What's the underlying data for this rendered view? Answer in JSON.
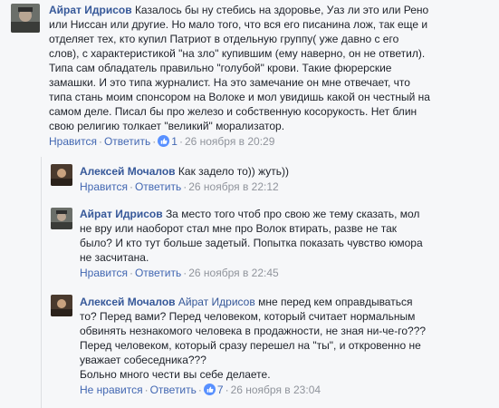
{
  "comments": [
    {
      "author": "Айрат Идрисов",
      "text_lines": [
        "Казалось бы ну стебись на здоровье, Уаз ли это или Рено",
        "или Ниссан или другие. Но мало того, что вся его писанина лож, так еще и",
        "отделяет тех, кто купил Патриот в отдельную группу( уже давно с его",
        "слов), с характеристикой \"на зло\" купившим (ему наверно, он не ответил).",
        "Типа сам обладатель правильно \"голубой\" крови. Такие фюрерские",
        "замашки. И это типа журналист. На это замечание он мне отвечает, что",
        "типа стань моим спонсором на Волоке и мол увидишь какой он честный на",
        "самом деле. Писал бы про железо и собственную косорукость. Нет блин",
        "свою религию толкает \"великий\" морализатор."
      ],
      "like_label": "Нравится",
      "reply_label": "Ответить",
      "reaction_count": "1",
      "timestamp": "26 ноября в 20:29"
    },
    {
      "author": "Алексей Мочалов",
      "text_lines": [
        "Как задело то)) жуть))"
      ],
      "like_label": "Нравится",
      "reply_label": "Ответить",
      "timestamp": "26 ноября в 22:12"
    },
    {
      "author": "Айрат Идрисов",
      "text_lines": [
        "За место того чтоб про свою же тему сказать, мол",
        "не вру или наоборот стал мне про Волок втирать, разве не так",
        "было? И кто тут больше задетый. Попытка показать чувство юмора",
        "не засчитана."
      ],
      "like_label": "Нравится",
      "reply_label": "Ответить",
      "timestamp": "26 ноября в 22:45"
    },
    {
      "author": "Алексей Мочалов",
      "mention": "Айрат Идрисов",
      "text_lines": [
        "мне перед кем оправдываться",
        "то? Перед вами? Перед человеком, который считает нормальным",
        "обвинять незнакомого человека в продажности, не зная ни-че-го???",
        "Перед человеком, который сразу перешел на \"ты\", и откровенно не",
        "уважает собеседника???",
        "Больно много чести вы себе делаете."
      ],
      "like_label": "Не нравится",
      "reply_label": "Ответить",
      "reaction_count": "7",
      "timestamp": "26 ноября в 23:04"
    }
  ],
  "colors": {
    "author": "#365899",
    "link": "#4267b2",
    "meta": "#90949c",
    "background": "#f6f7f9",
    "like_reaction": "#5890ff"
  },
  "icons": {
    "reaction": "thumbs-up-icon"
  }
}
